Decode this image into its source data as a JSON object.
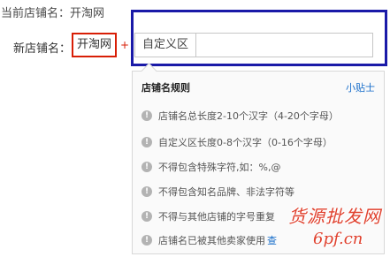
{
  "current_store": {
    "label": "当前店铺名：",
    "value": "开淘网"
  },
  "new_store": {
    "label": "新店铺名：",
    "name_value": "开淘网",
    "plus_symbol": "+",
    "custom_prefix": "自定义区",
    "custom_value": "",
    "custom_placeholder": ""
  },
  "rules": {
    "title": "店铺名规则",
    "tip_link": "小贴士",
    "items": [
      "店铺名总长度2-10个汉字（4-20个字母）",
      "自定义区长度0-8个汉字（0-16个字母）",
      "不得包含特殊字符,如：%,@",
      "不得包含知名品牌、非法字符等",
      "不得与其他店铺的字号重复",
      "店铺名已被其他卖家使用"
    ],
    "last_item_link": "查"
  },
  "watermark": {
    "line1": "货源批发网",
    "line2": "6pf.cn"
  },
  "colors": {
    "red_box": "#d81e06",
    "blue_box": "#1a1aa8",
    "link": "#1a6fcb",
    "watermark": "#e0412e"
  }
}
